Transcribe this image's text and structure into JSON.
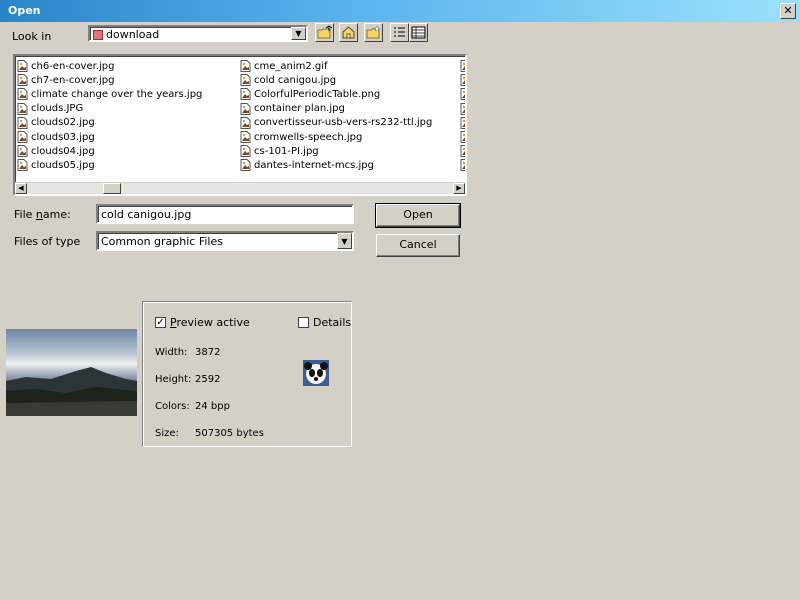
{
  "window": {
    "title": "Open",
    "close_glyph": "✕"
  },
  "look_in": {
    "label": "Look in",
    "value": "download",
    "toolbar": [
      "folder-up-icon",
      "home-icon",
      "new-folder-icon",
      "list-view-icon",
      "details-view-icon"
    ]
  },
  "files": {
    "col1": [
      "ch6-en-cover.jpg",
      "ch7-en-cover.jpg",
      "climate change over the years.jpg",
      "clouds.JPG",
      "clouds02.jpg",
      "clouds03.jpg",
      "clouds04.jpg",
      "clouds05.jpg"
    ],
    "col2": [
      "cme_anim2.gif",
      "cold canigou.jpg",
      "ColorfulPeriodicTable.png",
      "container plan.jpg",
      "convertisseur-usb-vers-rs232-ttl.jpg",
      "cromwells-speech.jpg",
      "cs-101-PI.jpg",
      "dantes-internet-mcs.jpg"
    ]
  },
  "file_name": {
    "label": "File name:",
    "value": "cold canigou.jpg"
  },
  "files_of_type": {
    "label": "Files of type",
    "value": "Common graphic Files"
  },
  "buttons": {
    "open": "Open",
    "cancel": "Cancel"
  },
  "preview": {
    "active_label": "Preview active",
    "active_checked": true,
    "details_label": "Details",
    "details_checked": false,
    "width_label": "Width:",
    "width_value": "3872",
    "height_label": "Height:",
    "height_value": "2592",
    "colors_label": "Colors:",
    "colors_value": "24 bpp",
    "size_label": "Size:",
    "size_value": "507305 bytes",
    "check_glyph": "✓"
  }
}
